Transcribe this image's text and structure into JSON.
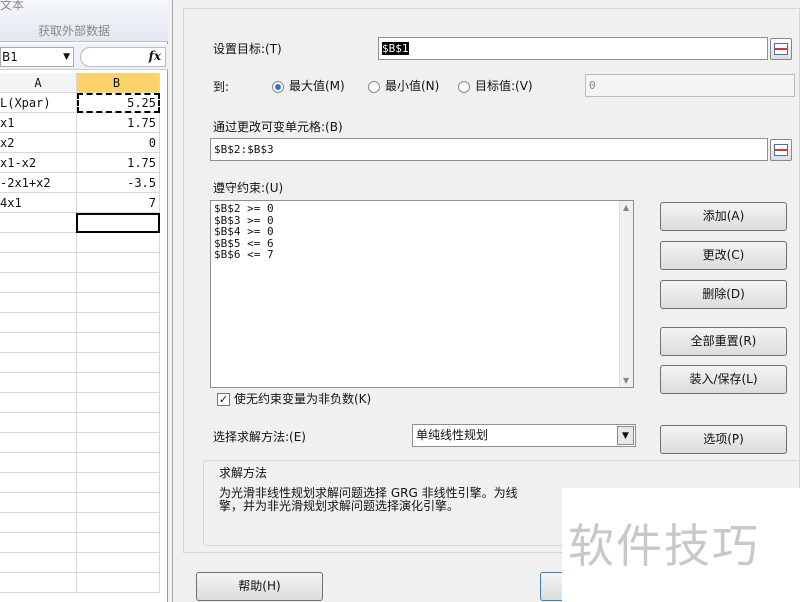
{
  "excel": {
    "ribbon_top": "文本",
    "ribbon_group": "获取外部数据",
    "name_box": "B1",
    "fx": "fx",
    "columns": [
      "A",
      "B"
    ],
    "rows": [
      {
        "a": "L(Xpar)",
        "b": "5.25"
      },
      {
        "a": "x1",
        "b": "1.75"
      },
      {
        "a": "x2",
        "b": "0"
      },
      {
        "a": "x1-x2",
        "b": "1.75"
      },
      {
        "a": "-2x1+x2",
        "b": "-3.5"
      },
      {
        "a": "4x1",
        "b": "7"
      }
    ]
  },
  "dialog": {
    "target_label": "设置目标:(T)",
    "target_value": "$B$1",
    "to_label": "到:",
    "radios": [
      {
        "label": "最大值(M)",
        "selected": true
      },
      {
        "label": "最小值(N)",
        "selected": false
      },
      {
        "label": "目标值:(V)",
        "selected": false
      }
    ],
    "value_of": "0",
    "changing_label": "通过更改可变单元格:(B)",
    "changing_value": "$B$2:$B$3",
    "constraints_label": "遵守约束:(U)",
    "constraints": [
      "$B$2 >= 0",
      "$B$3 >= 0",
      "$B$4 >= 0",
      "$B$5 <= 6",
      "$B$6 <= 7"
    ],
    "buttons": {
      "add": "添加(A)",
      "change": "更改(C)",
      "delete": "删除(D)",
      "reset": "全部重置(R)",
      "load_save": "装入/保存(L)",
      "options": "选项(P)",
      "help": "帮助(H)"
    },
    "nonneg_label": "使无约束变量为非负数(K)",
    "nonneg_checked": true,
    "method_label": "选择求解方法:(E)",
    "method_value": "单纯线性规划",
    "group_title": "求解方法",
    "group_text_1": "为光滑非线性规划求解问题选择 GRG 非线性引擎。为线",
    "group_text_2": "擎，并为非光滑规划求解问题选择演化引擎。"
  },
  "watermark": "软件技巧"
}
